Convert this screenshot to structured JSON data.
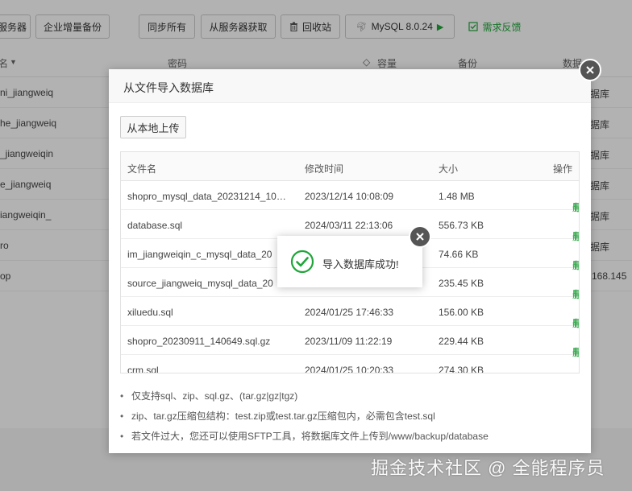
{
  "toolbar": {
    "buttons": [
      {
        "label": "服务器"
      },
      {
        "label": "企业增量备份"
      },
      {
        "label": "同步所有"
      },
      {
        "label": "从服务器获取"
      },
      {
        "label": "回收站"
      },
      {
        "label": "MySQL 8.0.24"
      },
      {
        "label": "需求反馈"
      }
    ]
  },
  "background_table": {
    "headers": {
      "name": "名",
      "password": "密码",
      "capacity": "容量",
      "backup": "备份",
      "location": "数据"
    },
    "rows": [
      {
        "name": "ni_jiangweiq",
        "type": "据库"
      },
      {
        "name": "he_jiangweiq",
        "type": "据库"
      },
      {
        "name": "_jiangweiqin",
        "type": "据库"
      },
      {
        "name": "e_jiangweiq",
        "type": "据库"
      },
      {
        "name": "iangweiqin_",
        "type": "据库"
      },
      {
        "name": "ro",
        "type": "据库"
      },
      {
        "name": "op",
        "type": "3.168.145"
      }
    ]
  },
  "modal": {
    "title": "从文件导入数据库",
    "upload_label": "从本地上传",
    "table": {
      "headers": {
        "name": "文件名",
        "time": "修改时间",
        "size": "大小",
        "ops": "操作"
      },
      "rows": [
        {
          "name": "shopro_mysql_data_20231214_10…",
          "time": "2023/12/14 10:08:09",
          "size": "1.48 MB"
        },
        {
          "name": "database.sql",
          "time": "2024/03/11 22:13:06",
          "size": "556.73 KB"
        },
        {
          "name": "im_jiangweiqin_c_mysql_data_20",
          "time": "",
          "size": "74.66 KB"
        },
        {
          "name": "source_jiangweiq_mysql_data_20",
          "time": "",
          "size": "235.45 KB"
        },
        {
          "name": "xiluedu.sql",
          "time": "2024/01/25 17:46:33",
          "size": "156.00 KB"
        },
        {
          "name": "shopro_20230911_140649.sql.gz",
          "time": "2023/11/09 11:22:19",
          "size": "229.44 KB"
        },
        {
          "name": "crm.sql",
          "time": "2024/01/25 10:20:33",
          "size": "274.30 KB"
        }
      ],
      "op_import": "导入",
      "op_sep": "|",
      "op_delete": "删除"
    },
    "notes": [
      "仅支持sql、zip、sql.gz、(tar.gz|gz|tgz)",
      "zip、tar.gz压缩包结构：test.zip或test.tar.gz压缩包内，必需包含test.sql",
      "若文件过大，您还可以使用SFTP工具，将数据库文件上传到/www/backup/database"
    ]
  },
  "toast": {
    "message": "导入数据库成功!"
  },
  "watermark": "掘金技术社区 @ 全能程序员",
  "colors": {
    "accent": "#20a53a",
    "mask": "rgba(0,0,0,0.30)",
    "close_bg": "#555555"
  }
}
